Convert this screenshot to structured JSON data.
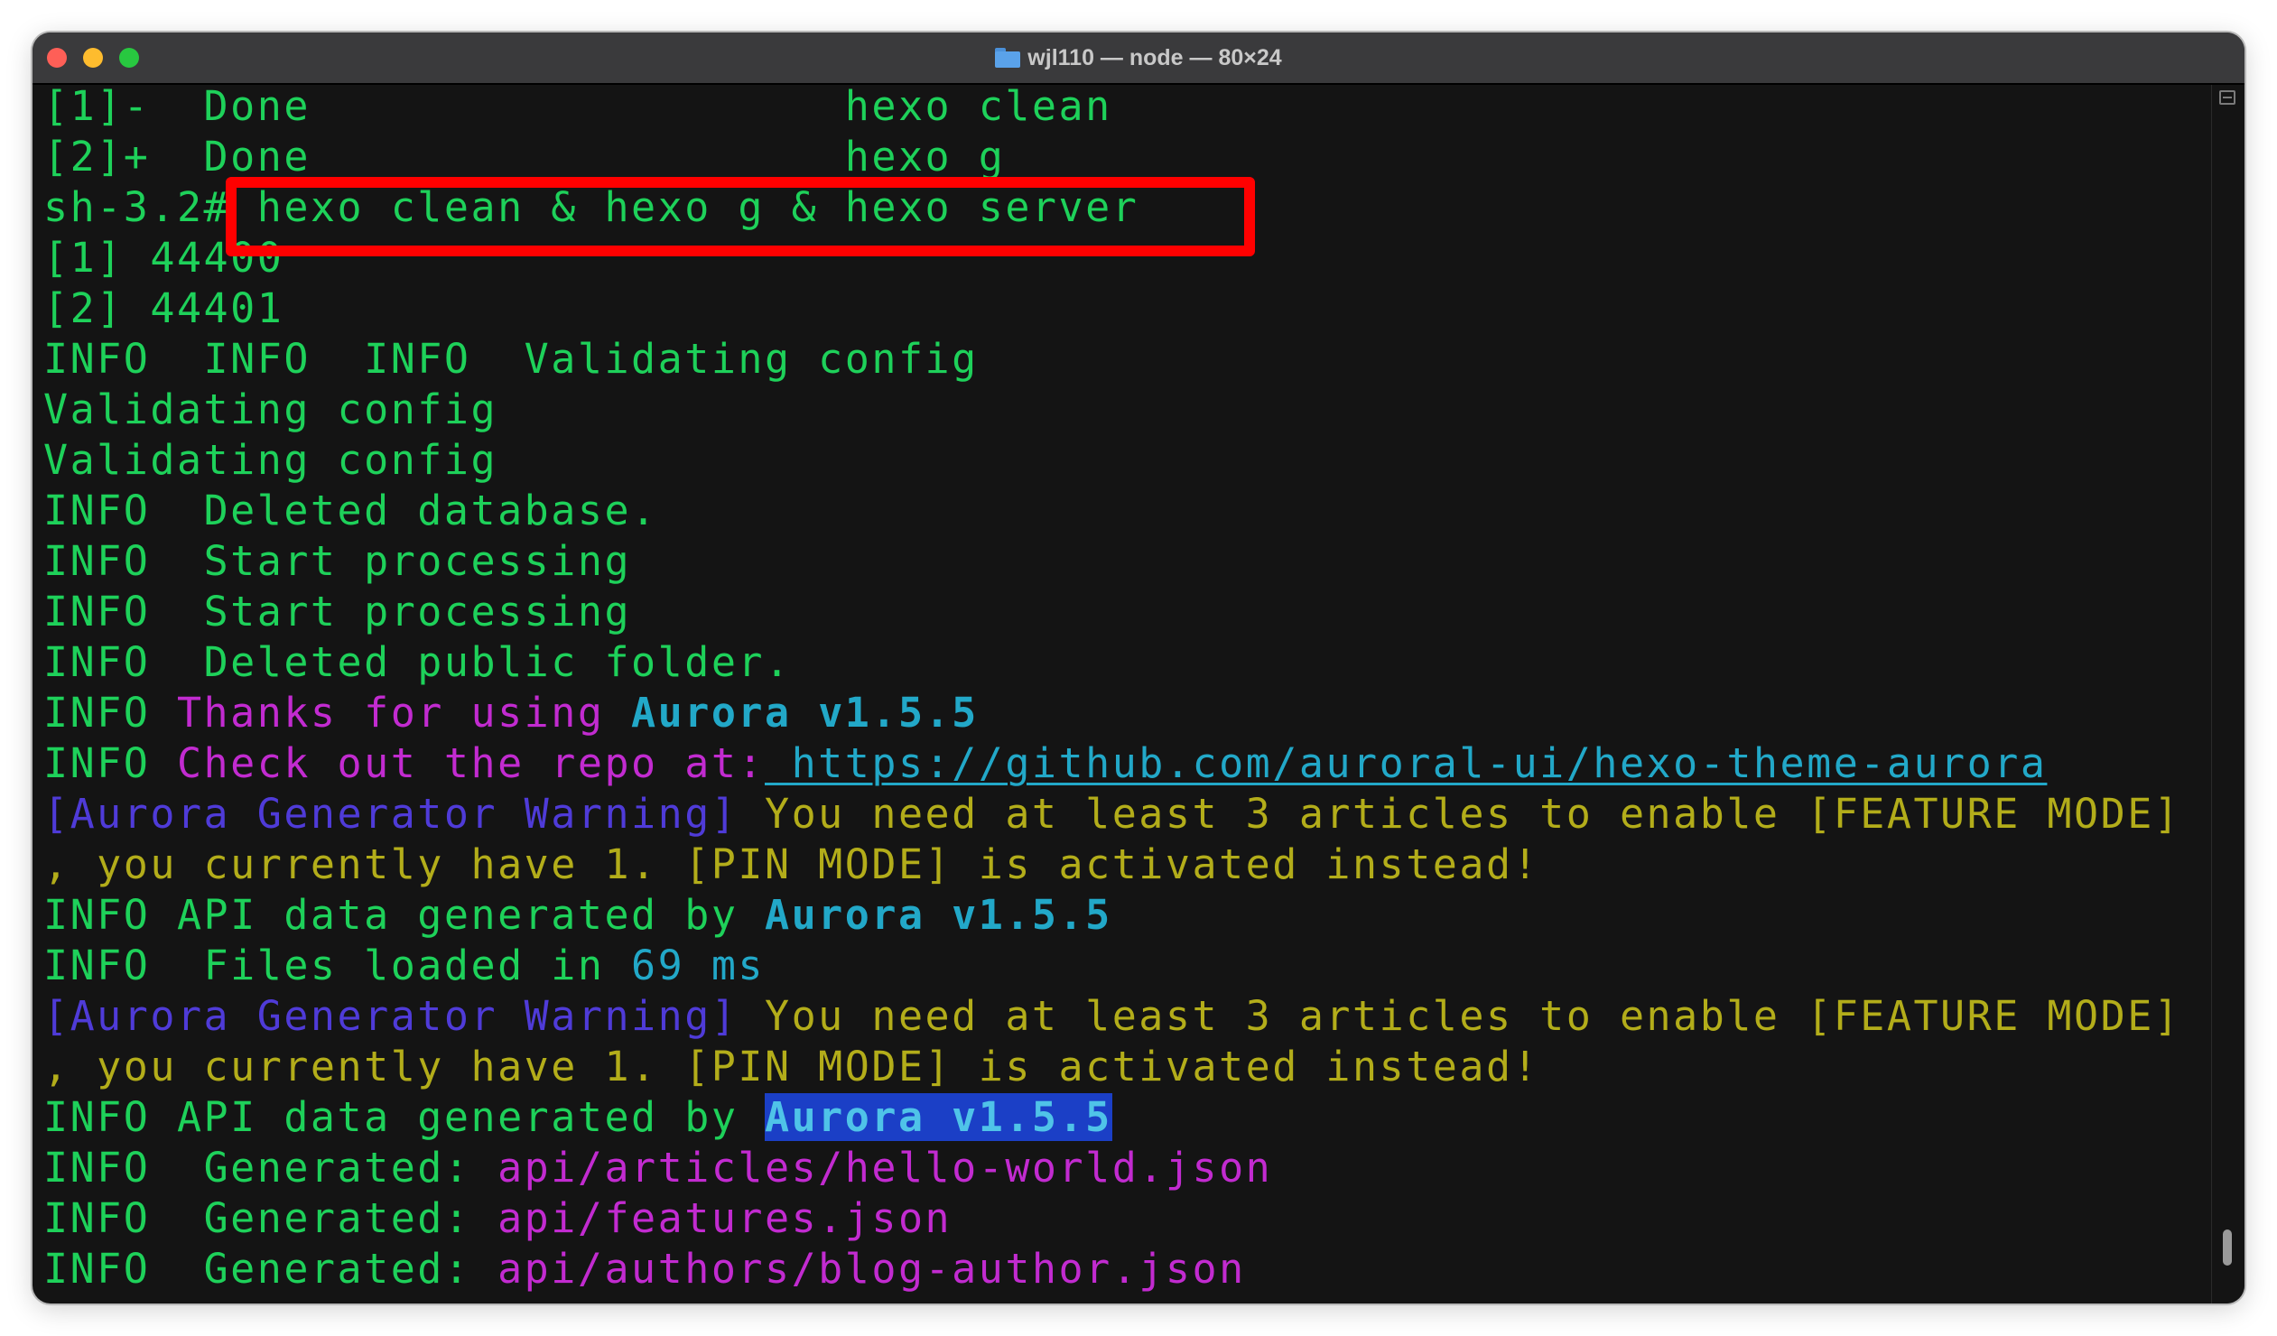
{
  "window": {
    "title": "wjl110 — node — 80×24",
    "title_icon": "folder-icon"
  },
  "terminal": {
    "lines": [
      {
        "segments": [
          {
            "text": "[1]-  Done                    hexo clean",
            "color": "green"
          }
        ]
      },
      {
        "segments": [
          {
            "text": "[2]+  Done                    hexo g",
            "color": "green"
          }
        ]
      },
      {
        "segments": [
          {
            "text": "sh-3.2# hexo clean & hexo g & hexo server",
            "color": "green"
          }
        ]
      },
      {
        "segments": [
          {
            "text": "[1] 44400",
            "color": "green"
          }
        ]
      },
      {
        "segments": [
          {
            "text": "[2] 44401",
            "color": "green"
          }
        ]
      },
      {
        "segments": [
          {
            "text": "INFO  INFO  INFO  ",
            "color": "green-dim"
          },
          {
            "text": "Validating config",
            "color": "green"
          }
        ]
      },
      {
        "segments": [
          {
            "text": "Validating config",
            "color": "green"
          }
        ]
      },
      {
        "segments": [
          {
            "text": "Validating config",
            "color": "green"
          }
        ]
      },
      {
        "segments": [
          {
            "text": "INFO  ",
            "color": "green-dim"
          },
          {
            "text": "Deleted database.",
            "color": "green"
          }
        ]
      },
      {
        "segments": [
          {
            "text": "INFO  ",
            "color": "green-dim"
          },
          {
            "text": "Start processing",
            "color": "green"
          }
        ]
      },
      {
        "segments": [
          {
            "text": "INFO  ",
            "color": "green-dim"
          },
          {
            "text": "Start processing",
            "color": "green"
          }
        ]
      },
      {
        "segments": [
          {
            "text": "INFO  ",
            "color": "green-dim"
          },
          {
            "text": "Deleted public folder.",
            "color": "green"
          }
        ]
      },
      {
        "segments": [
          {
            "text": "INFO ",
            "color": "green-dim"
          },
          {
            "text": "Thanks for using ",
            "color": "magenta"
          },
          {
            "text": "Aurora v1.5.5",
            "color": "cyan"
          }
        ]
      },
      {
        "segments": [
          {
            "text": "INFO ",
            "color": "green-dim"
          },
          {
            "text": "Check out the repo at:",
            "color": "magenta"
          },
          {
            "text": " https://github.com/auroral-ui/hexo-theme-aurora",
            "color": "link"
          }
        ]
      },
      {
        "segments": [
          {
            "text": "[Aurora Generator Warning]",
            "color": "blue"
          },
          {
            "text": " You need at least 3 articles to enable [FEATURE MODE]",
            "color": "yellow"
          }
        ]
      },
      {
        "segments": [
          {
            "text": ", you currently have 1. [PIN MODE] is activated instead!",
            "color": "yellow"
          }
        ]
      },
      {
        "segments": [
          {
            "text": "INFO ",
            "color": "green-dim"
          },
          {
            "text": "API data generated by ",
            "color": "green"
          },
          {
            "text": "Aurora v1.5.5",
            "color": "cyan"
          }
        ]
      },
      {
        "segments": [
          {
            "text": "INFO  ",
            "color": "green-dim"
          },
          {
            "text": "Files loaded in ",
            "color": "green"
          },
          {
            "text": "69 ms",
            "color": "cyan-plain"
          }
        ]
      },
      {
        "segments": [
          {
            "text": "[Aurora Generator Warning]",
            "color": "blue"
          },
          {
            "text": " You need at least 3 articles to enable [FEATURE MODE]",
            "color": "yellow"
          }
        ]
      },
      {
        "segments": [
          {
            "text": ", you currently have 1. [PIN MODE] is activated instead!",
            "color": "yellow"
          }
        ]
      },
      {
        "segments": [
          {
            "text": "INFO ",
            "color": "green-dim"
          },
          {
            "text": "API data generated by ",
            "color": "green"
          },
          {
            "text": "Aurora v1.5.5",
            "color": "highlight"
          }
        ]
      },
      {
        "segments": [
          {
            "text": "INFO  ",
            "color": "green-dim"
          },
          {
            "text": "Generated: ",
            "color": "green"
          },
          {
            "text": "api/articles/hello-world.json",
            "color": "magenta"
          }
        ]
      },
      {
        "segments": [
          {
            "text": "INFO  ",
            "color": "green-dim"
          },
          {
            "text": "Generated: ",
            "color": "green"
          },
          {
            "text": "api/features.json",
            "color": "magenta"
          }
        ]
      },
      {
        "segments": [
          {
            "text": "INFO  ",
            "color": "green-dim"
          },
          {
            "text": "Generated: ",
            "color": "green"
          },
          {
            "text": "api/authors/blog-author.json",
            "color": "magenta"
          }
        ]
      }
    ]
  },
  "annotation": {
    "highlighted_command": "hexo clean & hexo g & hexo server",
    "box_color": "#ff0000"
  },
  "colors": {
    "background": "#141414",
    "green": "#1ed15a",
    "magenta": "#c22bd0",
    "cyan": "#22a8c8",
    "blue": "#4f3bd8",
    "yellow": "#b3ad1a",
    "highlight_bg": "#1b3fc6"
  }
}
